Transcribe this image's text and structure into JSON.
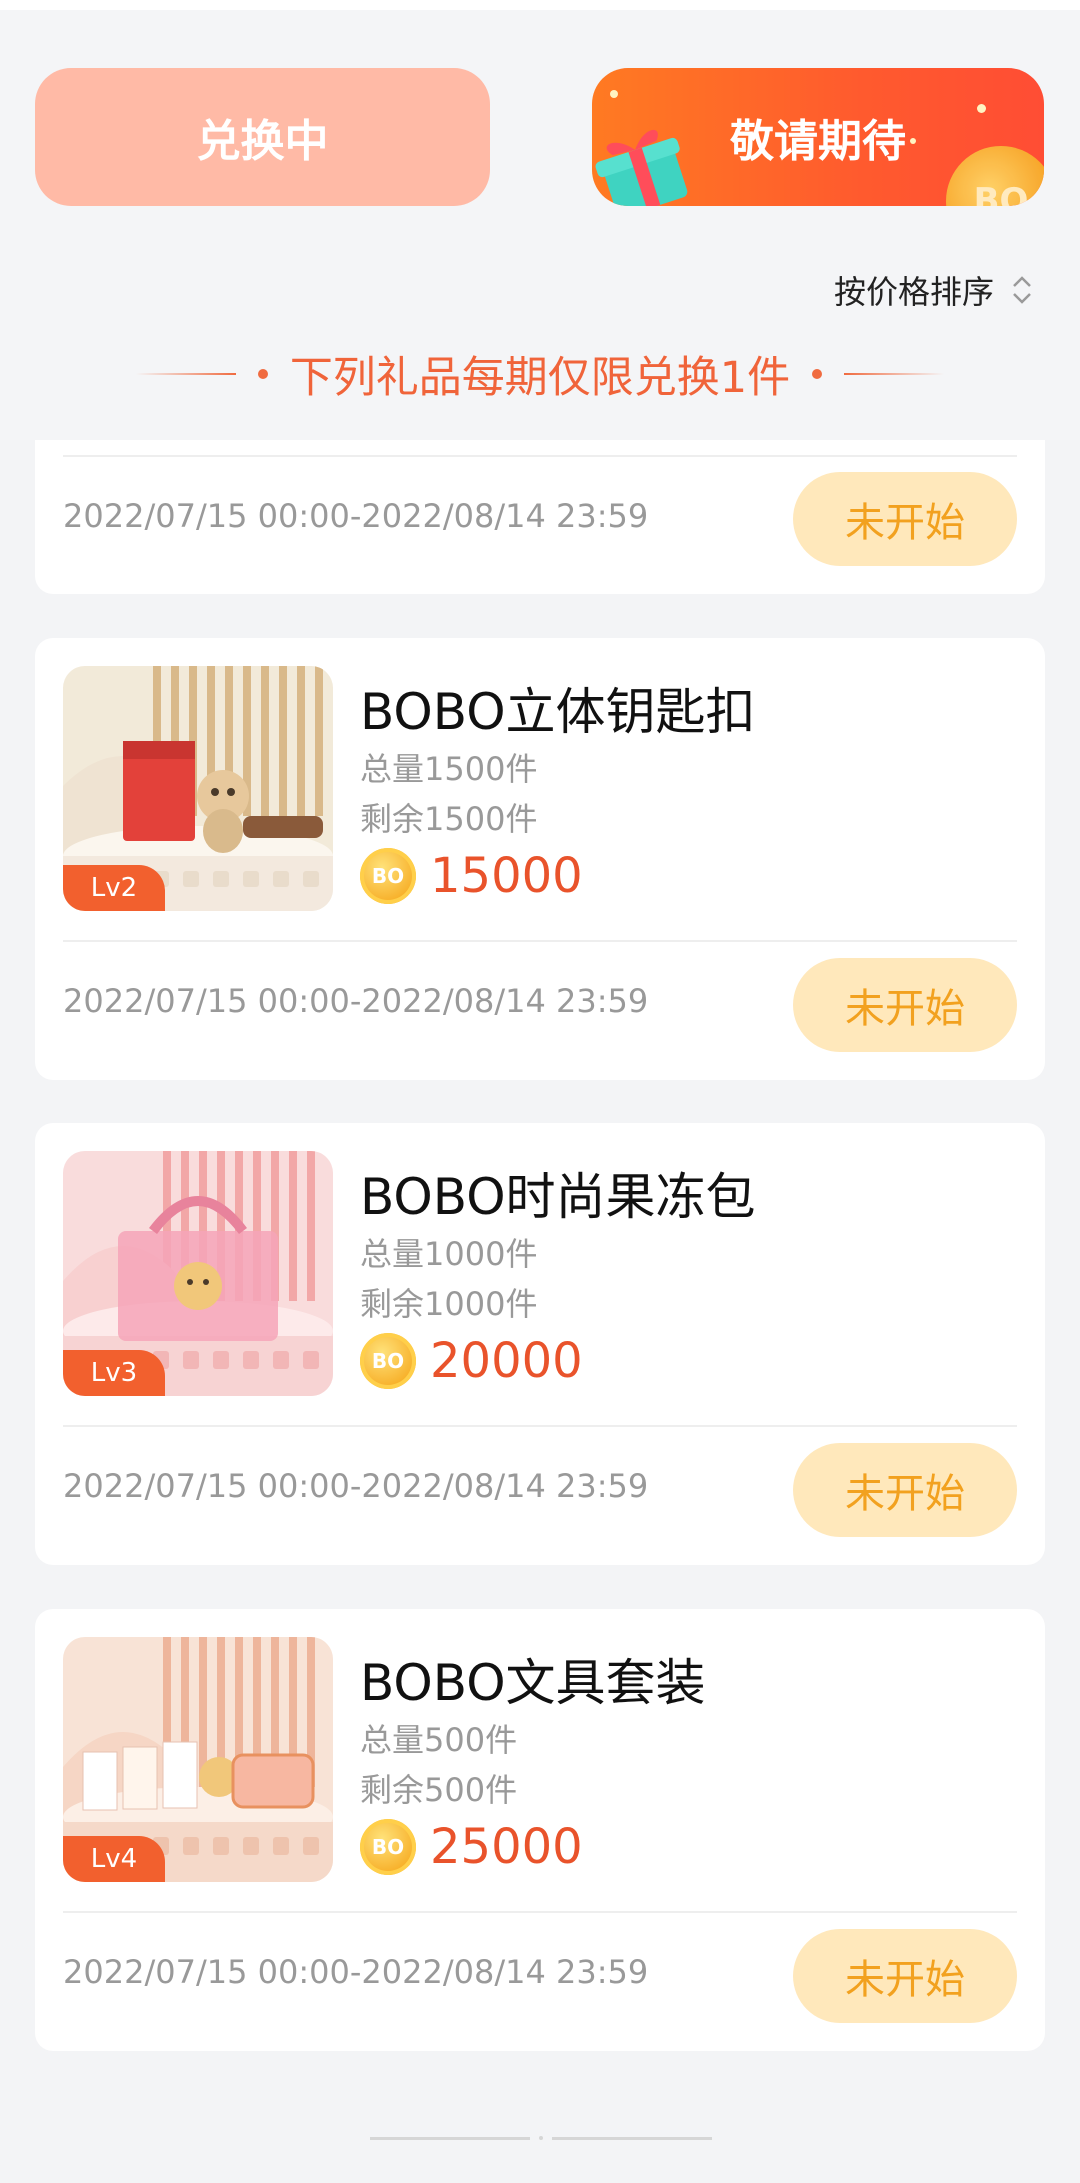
{
  "tabs": {
    "exchanging": "兑换中",
    "coming_soon": "敬请期待",
    "coin_deco_text": "BO"
  },
  "sort": {
    "label": "按价格排序"
  },
  "notice": {
    "text": "下列礼品每期仅限兑换1件"
  },
  "partial_card": {
    "time": "2022/07/15 00:00-2022/08/14 23:59",
    "status": "未开始"
  },
  "items": [
    {
      "title": "BOBO立体钥匙扣",
      "total": "总量1500件",
      "remain": "剩余1500件",
      "price": "15000",
      "coin_text": "BO",
      "level": "Lv2",
      "time": "2022/07/15 00:00-2022/08/14 23:59",
      "status": "未开始"
    },
    {
      "title": "BOBO时尚果冻包",
      "total": "总量1000件",
      "remain": "剩余1000件",
      "price": "20000",
      "coin_text": "BO",
      "level": "Lv3",
      "time": "2022/07/15 00:00-2022/08/14 23:59",
      "status": "未开始"
    },
    {
      "title": "BOBO文具套装",
      "total": "总量500件",
      "remain": "剩余500件",
      "price": "25000",
      "coin_text": "BO",
      "level": "Lv4",
      "time": "2022/07/15 00:00-2022/08/14 23:59",
      "status": "未开始"
    }
  ],
  "colors": {
    "accent": "#f0643a",
    "price": "#e9532b",
    "status_bg": "#ffe8bb",
    "status_text": "#f2a11f",
    "tab_inactive": "#ffbaa6"
  }
}
